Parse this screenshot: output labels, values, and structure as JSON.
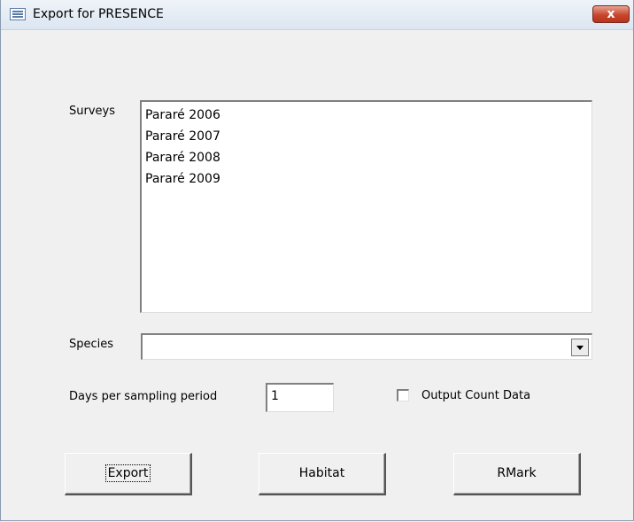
{
  "window": {
    "title": "Export for PRESENCE",
    "close_symbol": "x",
    "app_icon": "form-icon",
    "close_icon": "close-icon"
  },
  "surveys": {
    "label": "Surveys",
    "items": [
      "Pararé 2006",
      "Pararé 2007",
      "Pararé 2008",
      "Pararé 2009"
    ]
  },
  "species": {
    "label": "Species",
    "value": "",
    "dropdown_icon": "chevron-down-icon"
  },
  "days": {
    "label": "Days per sampling period",
    "value": "1"
  },
  "output_count": {
    "label": "Output Count Data",
    "checked": false
  },
  "buttons": {
    "export": "Export",
    "habitat": "Habitat",
    "rmark": "RMark"
  }
}
